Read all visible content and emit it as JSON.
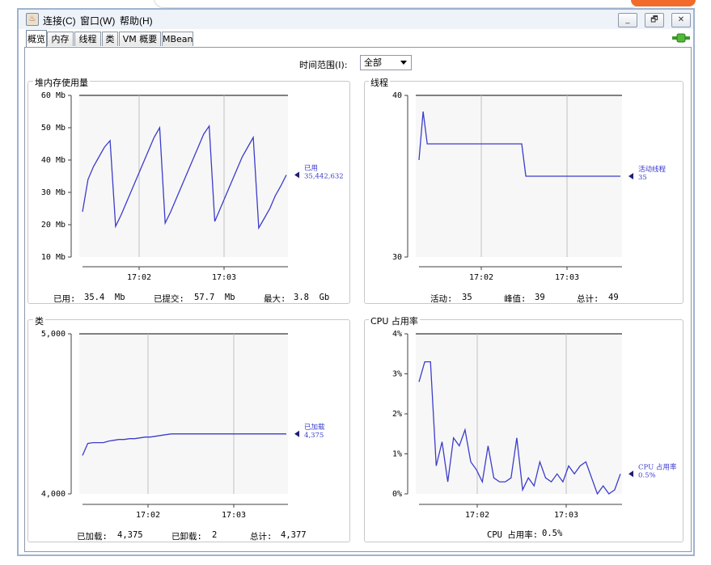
{
  "menu": {
    "connect": "连接(C)",
    "window": "窗口(W)",
    "help": "帮助(H)"
  },
  "window_buttons": {
    "minimize": "_",
    "maximize": "🗗",
    "close": "✕"
  },
  "tabs": [
    {
      "label": "概览",
      "active": true
    },
    {
      "label": "内存",
      "active": false
    },
    {
      "label": "线程",
      "active": false
    },
    {
      "label": "类",
      "active": false
    },
    {
      "label": "VM 概要",
      "active": false
    },
    {
      "label": "MBean",
      "active": false
    }
  ],
  "time_range": {
    "label": "时间范围(I):",
    "value": "全部"
  },
  "colors": {
    "series": "#3c3ccc",
    "grid": "#c0c0c0",
    "plot_bg": "#f7f7f7"
  },
  "panels": {
    "heap": {
      "title": "堆内存使用量",
      "label_name": "已用",
      "label_value": "35,442,632",
      "stats": [
        {
          "label": "已用:",
          "value": "35.4  Mb"
        },
        {
          "label": "已提交:",
          "value": "57.7  Mb"
        },
        {
          "label": "最大:",
          "value": "3.8  Gb"
        }
      ]
    },
    "threads": {
      "title": "线程",
      "label_name": "活动线程",
      "label_value": "35",
      "stats": [
        {
          "label": "活动:",
          "value": "35"
        },
        {
          "label": "峰值:",
          "value": "39"
        },
        {
          "label": "总计:",
          "value": "49"
        }
      ]
    },
    "classes": {
      "title": "类",
      "label_name": "已加载",
      "label_value": "4,375",
      "stats": [
        {
          "label": "已加载:",
          "value": "4,375"
        },
        {
          "label": "已卸载:",
          "value": "2"
        },
        {
          "label": "总计:",
          "value": "4,377"
        }
      ]
    },
    "cpu": {
      "title": "CPU 占用率",
      "label_name": "CPU 占用率",
      "label_value": "0.5%",
      "stats": [
        {
          "label": "CPU 占用率:",
          "value": "0.5%"
        }
      ]
    }
  },
  "chart_data": [
    {
      "type": "line",
      "id": "heap",
      "yticks": [
        "60 Mb",
        "50 Mb",
        "40 Mb",
        "30 Mb",
        "20 Mb",
        "10 Mb"
      ],
      "ylim": [
        10,
        60
      ],
      "xticks": [
        "17:02",
        "17:03"
      ],
      "values": [
        24,
        34,
        38,
        41,
        44,
        46,
        19.5,
        23,
        27,
        31,
        35,
        39,
        43,
        47,
        50,
        20.5,
        24,
        28,
        32,
        36,
        40,
        44,
        48,
        50.5,
        21,
        25,
        29,
        33,
        37,
        41,
        44,
        47,
        19,
        22,
        25,
        29,
        32,
        35.4
      ]
    },
    {
      "type": "line",
      "id": "threads",
      "yticks": [
        "40",
        "30"
      ],
      "ylim": [
        30,
        40
      ],
      "xticks": [
        "17:02",
        "17:03"
      ],
      "values": [
        36,
        39,
        37,
        37,
        37,
        37,
        37,
        37,
        37,
        37,
        37,
        37,
        37,
        37,
        37,
        37,
        37,
        37,
        37,
        37,
        37,
        37,
        37,
        37,
        37,
        37,
        35,
        35,
        35,
        35,
        35,
        35,
        35,
        35,
        35,
        35,
        35,
        35,
        35,
        35,
        35,
        35,
        35,
        35,
        35,
        35,
        35,
        35,
        35,
        35
      ]
    },
    {
      "type": "line",
      "id": "classes",
      "yticks": [
        "5,000",
        "4,000"
      ],
      "ylim": [
        4000,
        5000
      ],
      "xticks": [
        "17:02",
        "17:03"
      ],
      "values": [
        4240,
        4315,
        4320,
        4320,
        4320,
        4330,
        4335,
        4340,
        4340,
        4345,
        4345,
        4350,
        4355,
        4355,
        4360,
        4365,
        4370,
        4375,
        4375,
        4375,
        4375,
        4375,
        4375,
        4375,
        4375,
        4375,
        4375,
        4375,
        4375,
        4375,
        4375,
        4375,
        4375,
        4375,
        4375,
        4375,
        4375,
        4375,
        4375,
        4375
      ]
    },
    {
      "type": "line",
      "id": "cpu",
      "yticks": [
        "4%",
        "3%",
        "2%",
        "1%",
        "0%"
      ],
      "ylim": [
        0,
        4
      ],
      "xticks": [
        "17:02",
        "17:03"
      ],
      "values": [
        2.8,
        3.3,
        3.3,
        0.7,
        1.3,
        0.3,
        1.4,
        1.2,
        1.6,
        0.8,
        0.6,
        0.3,
        1.2,
        0.4,
        0.3,
        0.3,
        0.4,
        1.4,
        0.1,
        0.4,
        0.2,
        0.8,
        0.4,
        0.3,
        0.5,
        0.3,
        0.7,
        0.5,
        0.7,
        0.8,
        0.4,
        0.0,
        0.2,
        0.0,
        0.1,
        0.5
      ]
    }
  ]
}
